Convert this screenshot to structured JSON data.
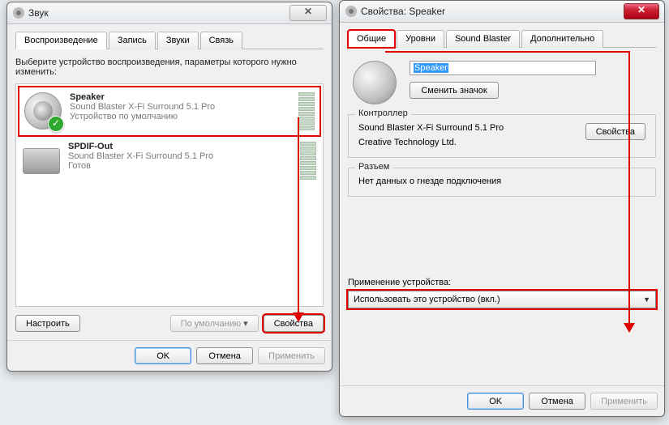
{
  "left_window": {
    "title": "Звук",
    "tabs": [
      "Воспроизведение",
      "Запись",
      "Звуки",
      "Связь"
    ],
    "active_tab_index": 0,
    "instruction": "Выберите устройство воспроизведения, параметры которого нужно изменить:",
    "devices": [
      {
        "name": "Speaker",
        "driver": "Sound Blaster X-Fi Surround 5.1 Pro",
        "status": "Устройство по умолчанию",
        "default": true,
        "selected": true,
        "icon": "speaker"
      },
      {
        "name": "SPDIF-Out",
        "driver": "Sound Blaster X-Fi Surround 5.1 Pro",
        "status": "Готов",
        "default": false,
        "selected": false,
        "icon": "spdif"
      }
    ],
    "buttons": {
      "configure": "Настроить",
      "set_default": "По умолчанию",
      "properties": "Свойства"
    },
    "dialog_buttons": {
      "ok": "OK",
      "cancel": "Отмена",
      "apply": "Применить"
    }
  },
  "right_window": {
    "title": "Свойства: Speaker",
    "tabs": [
      "Общие",
      "Уровни",
      "Sound Blaster",
      "Дополнительно"
    ],
    "active_tab_index": 0,
    "name_field_value": "Speaker",
    "change_icon_button": "Сменить значок",
    "controller": {
      "group_title": "Контроллер",
      "line1": "Sound Blaster X-Fi Surround 5.1 Pro",
      "line2": "Creative Technology Ltd.",
      "properties_button": "Свойства"
    },
    "jack": {
      "group_title": "Разъем",
      "text": "Нет данных о гнезде подключения"
    },
    "usage": {
      "label": "Применение устройства:",
      "selected": "Использовать это устройство (вкл.)"
    },
    "dialog_buttons": {
      "ok": "OK",
      "cancel": "Отмена",
      "apply": "Применить"
    }
  }
}
